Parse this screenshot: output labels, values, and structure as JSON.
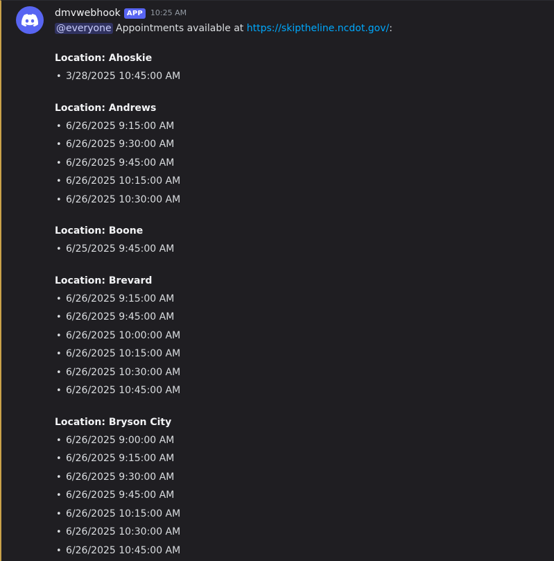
{
  "message": {
    "username": "dmvwebhook",
    "badge": "APP",
    "timestamp": "10:25 AM",
    "mention": "@everyone",
    "intro_text": " Appointments available at ",
    "link": "https://skiptheline.ncdot.gov/",
    "intro_end": ":",
    "avatar_icon": "discord-logo-icon",
    "accent_color": "#5865f2",
    "border_color": "#c9a24a"
  },
  "locations": [
    {
      "title": "Location: Ahoskie",
      "slots": [
        "3/28/2025 10:45:00 AM"
      ]
    },
    {
      "title": "Location: Andrews",
      "slots": [
        "6/26/2025 9:15:00 AM",
        "6/26/2025 9:30:00 AM",
        "6/26/2025 9:45:00 AM",
        "6/26/2025 10:15:00 AM",
        "6/26/2025 10:30:00 AM"
      ]
    },
    {
      "title": "Location: Boone",
      "slots": [
        "6/25/2025 9:45:00 AM"
      ]
    },
    {
      "title": "Location: Brevard",
      "slots": [
        "6/26/2025 9:15:00 AM",
        "6/26/2025 9:45:00 AM",
        "6/26/2025 10:00:00 AM",
        "6/26/2025 10:15:00 AM",
        "6/26/2025 10:30:00 AM",
        "6/26/2025 10:45:00 AM"
      ]
    },
    {
      "title": "Location: Bryson City",
      "slots": [
        "6/26/2025 9:00:00 AM",
        "6/26/2025 9:15:00 AM",
        "6/26/2025 9:30:00 AM",
        "6/26/2025 9:45:00 AM",
        "6/26/2025 10:15:00 AM",
        "6/26/2025 10:30:00 AM",
        "6/26/2025 10:45:00 AM"
      ]
    }
  ]
}
